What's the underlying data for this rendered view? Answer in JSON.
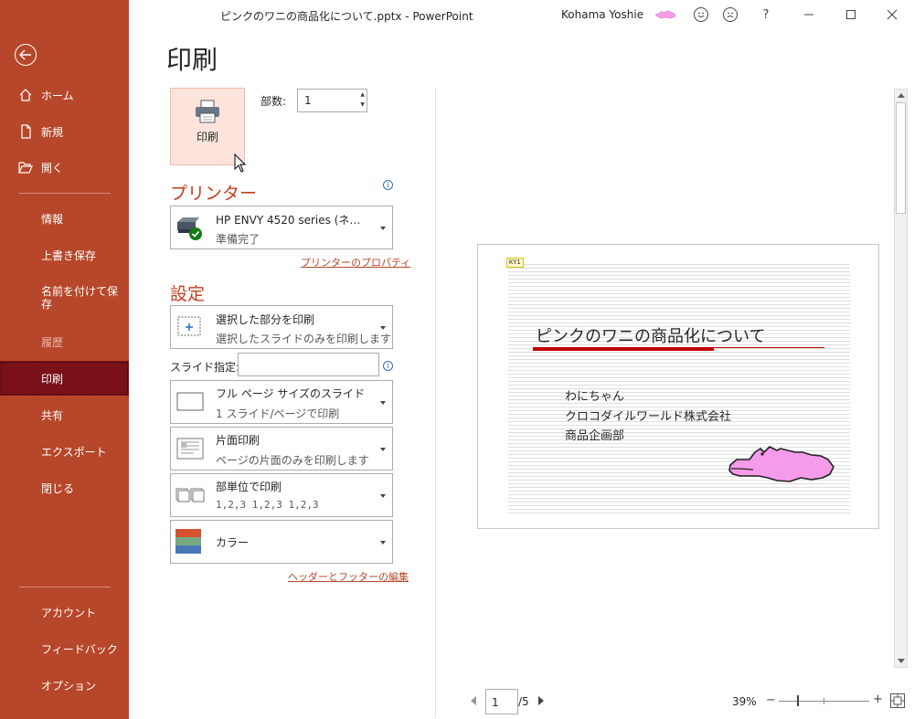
{
  "window": {
    "title": "ピンクのワニの商品化について.pptx  -  PowerPoint",
    "user": "Kohama Yoshie",
    "help_label": "?"
  },
  "nav": {
    "items": [
      {
        "label": "ホーム",
        "icon": "home-icon"
      },
      {
        "label": "新規",
        "icon": "new-document-icon"
      },
      {
        "label": "開く",
        "icon": "open-folder-icon"
      },
      {
        "label": "情報"
      },
      {
        "label": "上書き保存"
      },
      {
        "label": "名前を付けて保\n存"
      },
      {
        "label": "履歴"
      },
      {
        "label": "印刷"
      },
      {
        "label": "共有"
      },
      {
        "label": "エクスポート"
      },
      {
        "label": "閉じる"
      },
      {
        "label": "アカウント"
      },
      {
        "label": "フィードバック"
      },
      {
        "label": "オプション"
      }
    ]
  },
  "print": {
    "heading": "印刷",
    "button_label": "印刷",
    "copies_label": "部数:",
    "copies_value": "1"
  },
  "printer": {
    "section_title": "プリンター",
    "name": "HP ENVY 4520 series (ネ…",
    "status": "準備完了",
    "properties_link": "プリンターのプロパティ"
  },
  "settings": {
    "section_title": "設定",
    "range": {
      "title": "選択した部分を印刷",
      "desc": "選択したスライドのみを印刷します"
    },
    "slides_label": "スライド指定:",
    "slides_value": "",
    "layout": {
      "title": "フル ページ サイズのスライド",
      "desc": "1 スライド/ページで印刷"
    },
    "sides": {
      "title": "片面印刷",
      "desc": "ページの片面のみを印刷します"
    },
    "collate": {
      "title": "部単位で印刷",
      "desc": "1,2,3    1,2,3    1,2,3"
    },
    "color": {
      "title": "カラー"
    },
    "header_footer_link": "ヘッダーとフッターの編集"
  },
  "preview": {
    "tag": "KY1",
    "slide_title": "ピンクのワニの商品化について",
    "lines": [
      "わにちゃん",
      "クロコダイルワールド株式会社",
      "商品企画部"
    ],
    "page_current": "1",
    "page_total": "/5",
    "zoom": "39%"
  },
  "colors": {
    "accent": "#b7472a",
    "active_nav": "#7a1018",
    "slide_accent": "#c00000",
    "croc": "#f59bea"
  }
}
